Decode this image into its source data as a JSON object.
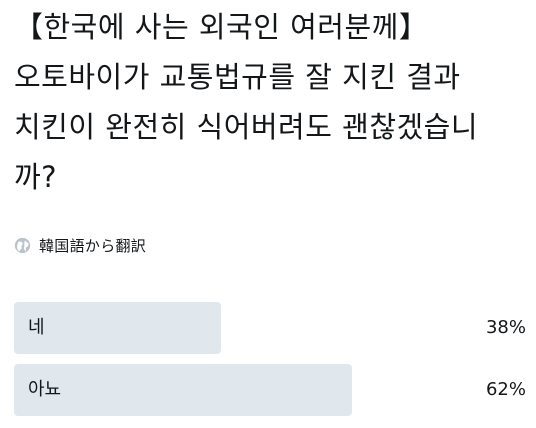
{
  "tweet": {
    "lines": [
      "【한국에 사는 외국인 여러분께】",
      "오토바이가 교통법규를 잘 지킨 결과",
      "치킨이 완전히 식어버려도 괜찮겠습니",
      "까?"
    ]
  },
  "translate": {
    "icon": "globe-icon",
    "label": "韓国語から翻訳"
  },
  "poll": {
    "options": [
      {
        "label": "네",
        "percent": "38%",
        "value": 0.38
      },
      {
        "label": "아뇨",
        "percent": "62%",
        "value": 0.62
      }
    ],
    "bar_color": "#e1e8ed"
  }
}
